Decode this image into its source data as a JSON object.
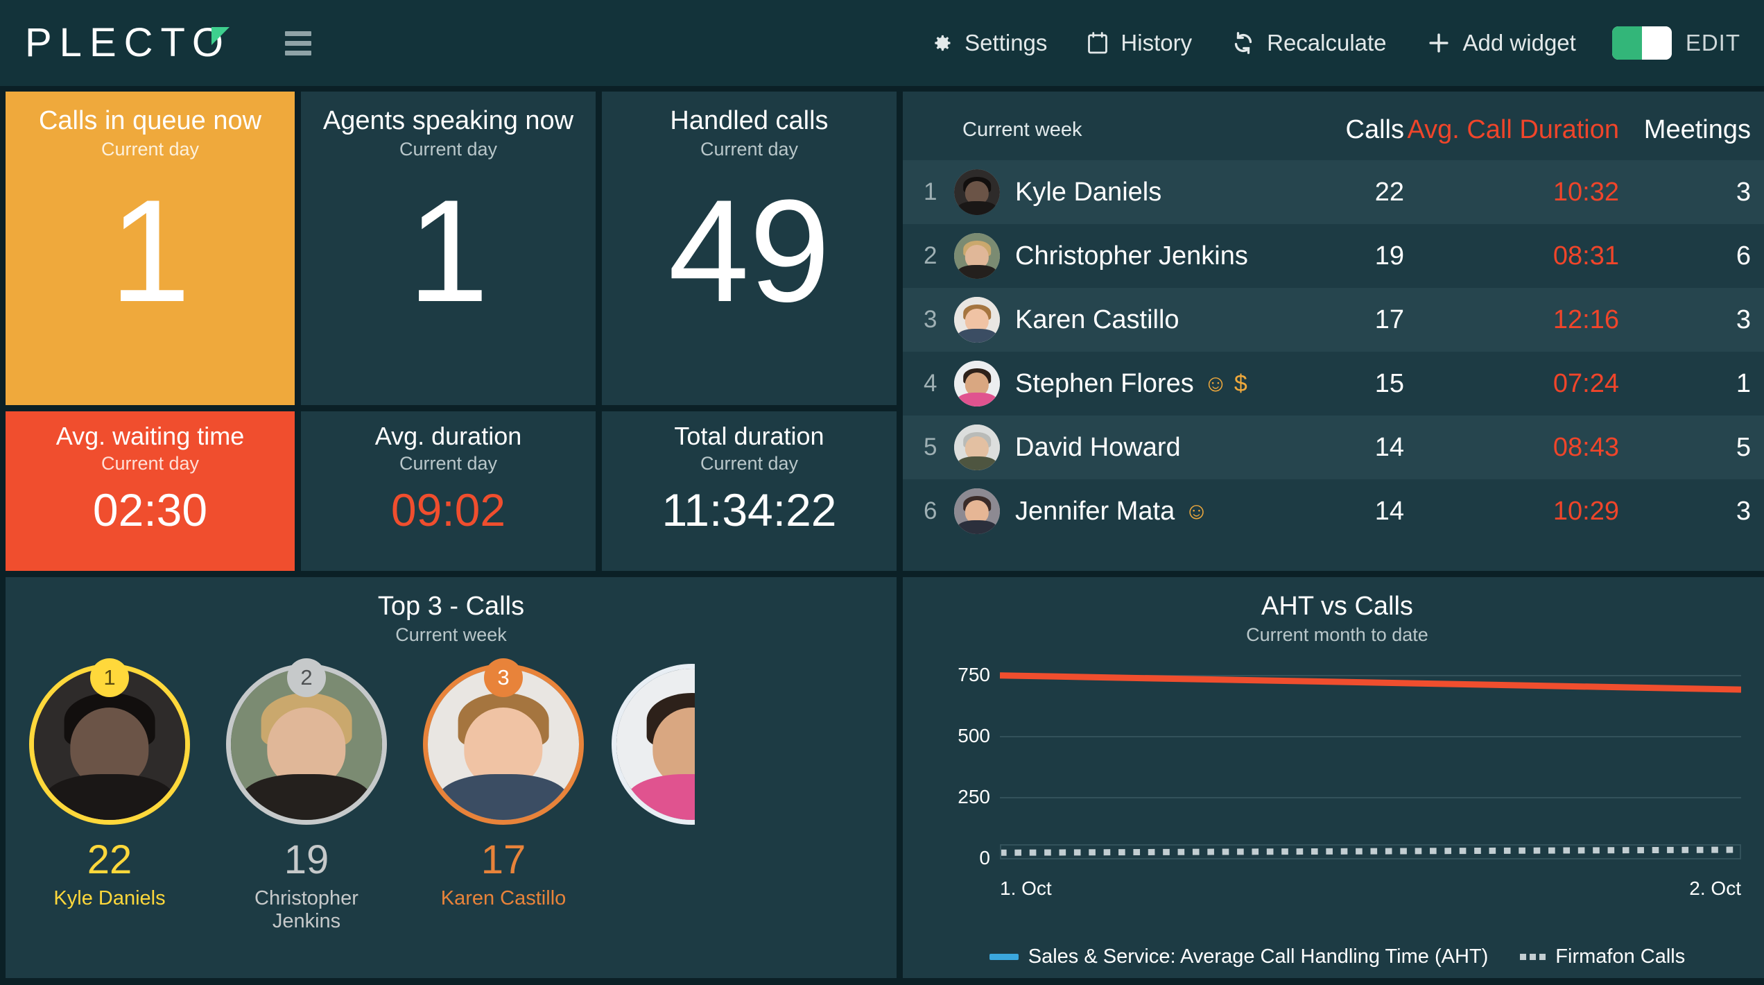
{
  "brand": {
    "name": "PLECTO",
    "accent": "#3ecf8e"
  },
  "toolbar": {
    "settings": "Settings",
    "history": "History",
    "recalculate": "Recalculate",
    "add_widget": "Add widget",
    "edit_label": "EDIT",
    "toggle_state": "on",
    "toggle_color": "#33b679"
  },
  "kpis": [
    {
      "title": "Calls in queue now",
      "subtitle": "Current day",
      "value": "1",
      "bg": "#efa93c",
      "value_color": "#ffffff"
    },
    {
      "title": "Agents speaking now",
      "subtitle": "Current day",
      "value": "1",
      "bg": "#1d3b44",
      "value_color": "#ffffff"
    },
    {
      "title": "Handled calls",
      "subtitle": "Current day",
      "value": "49",
      "bg": "#1d3b44",
      "value_color": "#ffffff"
    },
    {
      "title": "Avg. waiting time",
      "subtitle": "Current day",
      "value": "02:30",
      "bg": "#f04e2e",
      "value_color": "#ffffff"
    },
    {
      "title": "Avg. duration",
      "subtitle": "Current day",
      "value": "09:02",
      "bg": "#1d3b44",
      "value_color": "#f04e2e"
    },
    {
      "title": "Total duration",
      "subtitle": "Current day",
      "value": "11:34:22",
      "bg": "#1d3b44",
      "value_color": "#ffffff"
    }
  ],
  "leaderboard": {
    "period": "Current week",
    "columns": {
      "calls": "Calls",
      "duration": "Avg. Call Duration",
      "meetings": "Meetings"
    },
    "rows": [
      {
        "rank": "1",
        "name": "Kyle Daniels",
        "badges": "",
        "calls": "22",
        "duration": "10:32",
        "meetings": "3"
      },
      {
        "rank": "2",
        "name": "Christopher Jenkins",
        "badges": "",
        "calls": "19",
        "duration": "08:31",
        "meetings": "6"
      },
      {
        "rank": "3",
        "name": "Karen Castillo",
        "badges": "",
        "calls": "17",
        "duration": "12:16",
        "meetings": "3"
      },
      {
        "rank": "4",
        "name": "Stephen Flores",
        "badges": "☺ $",
        "calls": "15",
        "duration": "07:24",
        "meetings": "1"
      },
      {
        "rank": "5",
        "name": "David Howard",
        "badges": "",
        "calls": "14",
        "duration": "08:43",
        "meetings": "5"
      },
      {
        "rank": "6",
        "name": "Jennifer Mata",
        "badges": "☺",
        "calls": "14",
        "duration": "10:29",
        "meetings": "3"
      }
    ]
  },
  "top3": {
    "title": "Top 3 - Calls",
    "subtitle": "Current week",
    "items": [
      {
        "rank": "1",
        "value": "22",
        "name": "Kyle Daniels",
        "color": "#ffd83b"
      },
      {
        "rank": "2",
        "value": "19",
        "name": "Christopher Jenkins",
        "color": "#c6c9ca"
      },
      {
        "rank": "3",
        "value": "17",
        "name": "Karen Castillo",
        "color": "#e8833a"
      }
    ]
  },
  "chart_data": {
    "type": "line",
    "title": "AHT vs Calls",
    "subtitle": "Current month to date",
    "xlabel": "",
    "ylabel": "",
    "x": [
      "1. Oct",
      "2. Oct"
    ],
    "xticks": [
      "1. Oct",
      "2. Oct"
    ],
    "yticks": [
      0,
      250,
      500,
      750
    ],
    "ylim": [
      0,
      800
    ],
    "grid": true,
    "legend_position": "bottom",
    "series": [
      {
        "name": "Sales & Service: Average Call Handling Time (AHT)",
        "style": "solid",
        "color": "#f04e2e",
        "legend_color": "#3ba7dd",
        "values": [
          748,
          690
        ]
      },
      {
        "name": "Firmafon Calls",
        "style": "dotted",
        "color": "#c3ced2",
        "values": [
          22,
          34
        ]
      }
    ]
  }
}
